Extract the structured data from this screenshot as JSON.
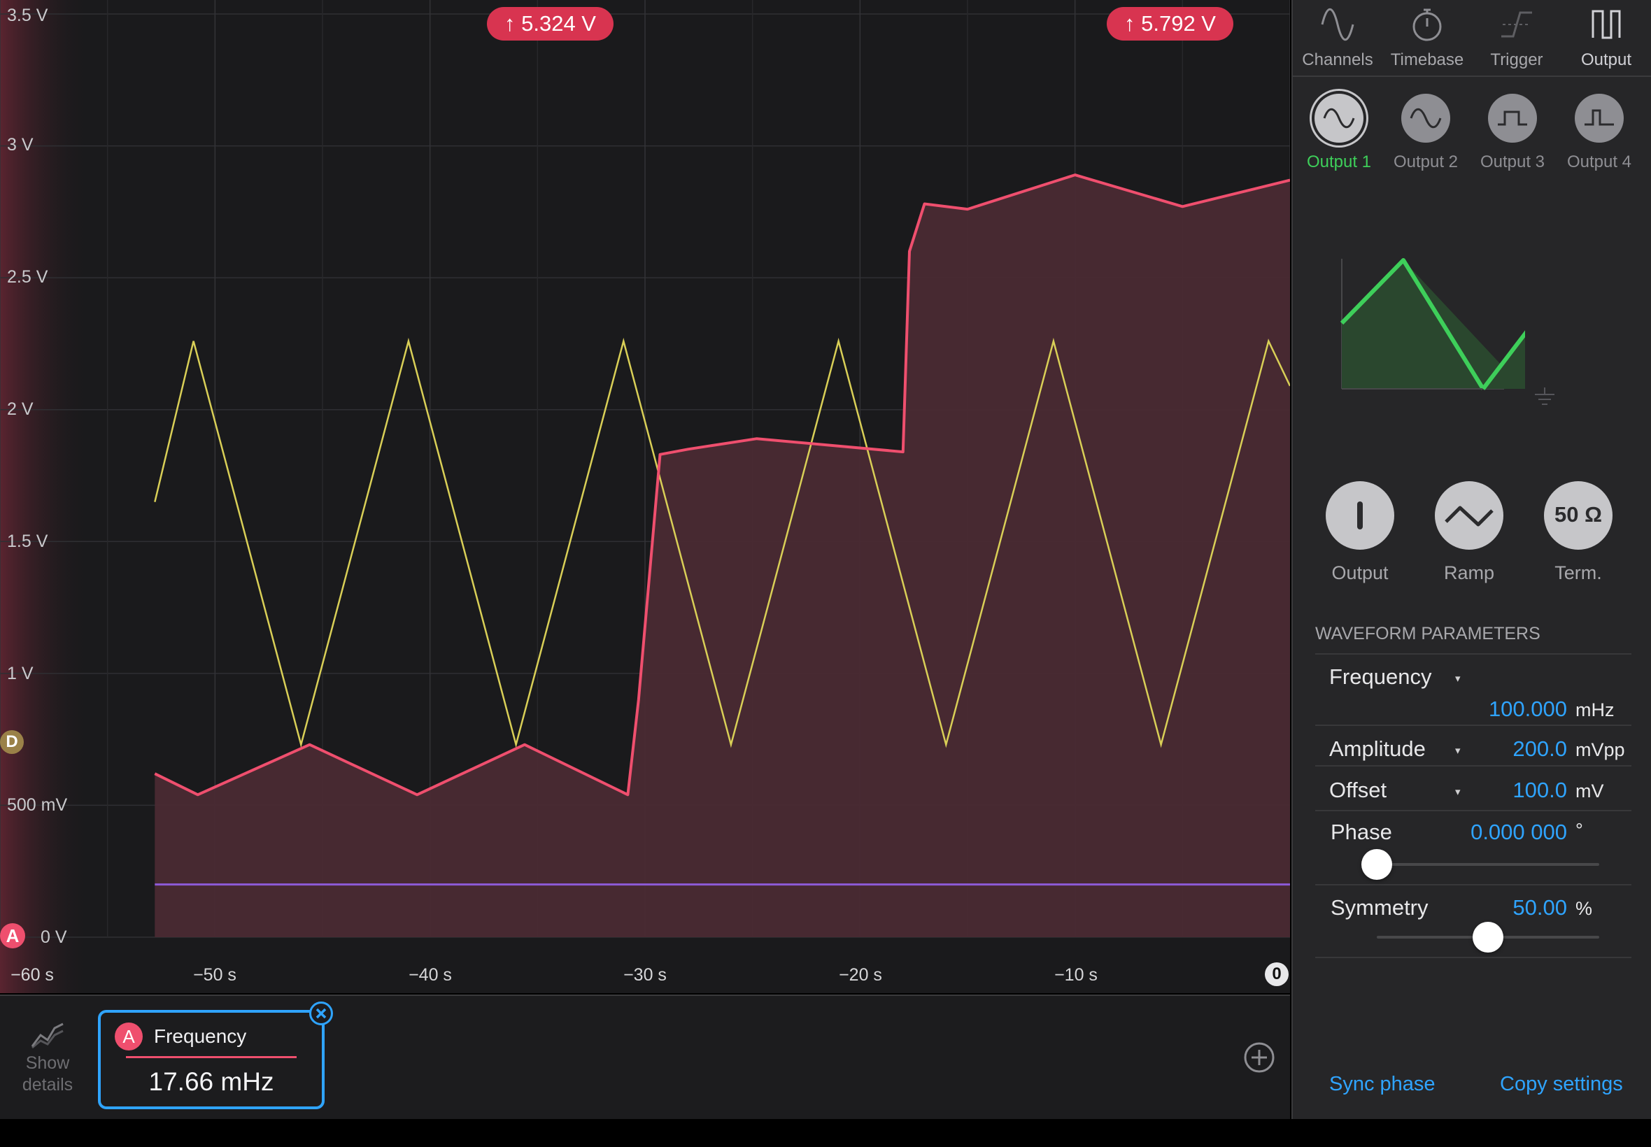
{
  "scope": {
    "y_axis_labels": [
      "3.5 V",
      "3 V",
      "2.5 V",
      "2 V",
      "1.5 V",
      "1 V",
      "500 mV",
      "0 V"
    ],
    "x_axis_labels": [
      "−60 s",
      "−50 s",
      "−40 s",
      "−30 s",
      "−20 s",
      "−10 s"
    ],
    "zero_marker": "0",
    "channel_a_marker": "A",
    "channel_d_marker": "D",
    "cursor_1": "↑ 5.324 V",
    "cursor_2": "↑ 5.792 V",
    "colors": {
      "channel_a": "#ef4f6e",
      "channel_a_fill": "#4a2a33",
      "reference": "#d9cf57",
      "channel_d": "#8d5ad8"
    }
  },
  "chart_data": {
    "type": "line",
    "xlim": [
      -60,
      0
    ],
    "ylim": [
      0,
      3.5
    ],
    "xlabel": "",
    "ylabel": "",
    "series": [
      {
        "name": "",
        "color": "#ef4f6e",
        "x": [
          -52.8,
          -50.8,
          -45.6,
          -40.6,
          -35.6,
          -30.8,
          -30.3,
          -29.3,
          -28,
          -24.8,
          -18,
          -17.7,
          -17,
          -15,
          -10,
          -5,
          0
        ],
        "y": [
          0.62,
          0.54,
          0.73,
          0.54,
          0.73,
          0.54,
          0.9,
          1.83,
          1.85,
          1.89,
          1.84,
          2.6,
          2.78,
          2.76,
          2.89,
          2.77,
          2.87
        ]
      },
      {
        "name": "",
        "color": "#d9cf57",
        "x": [
          -52.8,
          -51,
          -46,
          -41,
          -36,
          -31,
          -26,
          -21,
          -16,
          -11,
          -6,
          -1,
          0
        ],
        "y": [
          1.65,
          2.26,
          0.73,
          2.26,
          0.73,
          2.26,
          0.73,
          2.26,
          0.73,
          2.26,
          0.73,
          2.26,
          2.09
        ]
      },
      {
        "name": "",
        "color": "#8d5ad8",
        "x": [
          -52.8,
          0
        ],
        "y": [
          0.2,
          0.2
        ]
      }
    ]
  },
  "bottom": {
    "show_details_line1": "Show",
    "show_details_line2": "details",
    "measurement": {
      "channel": "A",
      "label": "Frequency",
      "value": "17.66 mHz"
    }
  },
  "panel": {
    "nav": [
      "Channels",
      "Timebase",
      "Trigger",
      "Output"
    ],
    "outputs": [
      "Output 1",
      "Output 2",
      "Output 3",
      "Output 4"
    ],
    "active_output_color": "#3ecf5a",
    "buttons": {
      "output": "Output",
      "ramp": "Ramp",
      "term": "Term.",
      "term_value": "50 Ω"
    },
    "section_title": "WAVEFORM PARAMETERS",
    "params": {
      "frequency": {
        "label": "Frequency",
        "value": "100.000",
        "unit": "mHz"
      },
      "amplitude": {
        "label": "Amplitude",
        "value": "200.0",
        "unit": "mVpp"
      },
      "offset": {
        "label": "Offset",
        "value": "100.0",
        "unit": "mV"
      },
      "phase": {
        "label": "Phase",
        "value": "0.000 000",
        "unit": "°",
        "level": 0.0
      },
      "symmetry": {
        "label": "Symmetry",
        "value": "50.00",
        "unit": "%",
        "level": 0.5
      }
    },
    "dropdown_caret": "▾",
    "sync_phase": "Sync phase",
    "copy_settings": "Copy settings"
  }
}
